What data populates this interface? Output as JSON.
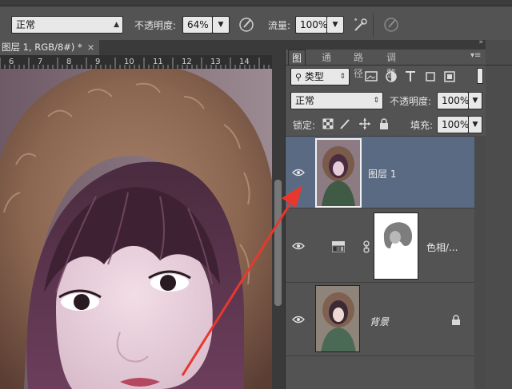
{
  "options_bar": {
    "mode_value": "正常",
    "opacity_label": "不透明度:",
    "opacity_value": "64%",
    "flow_label": "流量:",
    "flow_value": "100%"
  },
  "document": {
    "tab_title": "图层 1, RGB/8#) *",
    "close_glyph": "×",
    "ruler_ticks": [
      "6",
      "7",
      "8",
      "9",
      "10",
      "11",
      "12",
      "13",
      "14",
      "15"
    ]
  },
  "layers_panel": {
    "tabs": [
      "图层",
      "通道",
      "路径",
      "调整"
    ],
    "filter_kind": "类型",
    "blend_mode": "正常",
    "opacity_label": "不透明度:",
    "opacity_value": "100%",
    "lock_label": "锁定:",
    "fill_label": "填充:",
    "fill_value": "100%",
    "layers": [
      {
        "name": "图层 1",
        "selected": true
      },
      {
        "name": "色相/...",
        "selected": false
      },
      {
        "name": "背景",
        "selected": false,
        "locked": true
      }
    ]
  },
  "colors": {
    "panel_bg": "#535353",
    "selected_layer": "#5a6a82",
    "arrow": "#e8382e"
  },
  "icons": [
    "airbrush-icon",
    "pressure-icon",
    "search-icon",
    "image-filter-icon",
    "adjust-filter-icon",
    "type-filter-icon",
    "shape-filter-icon",
    "smartobject-filter-icon",
    "lock-pixels-icon",
    "lock-brush-icon",
    "lock-move-icon",
    "lock-all-icon",
    "eye-icon",
    "mask-link-icon",
    "adjustment-layer-icon",
    "lock-icon",
    "panel-menu-icon"
  ]
}
